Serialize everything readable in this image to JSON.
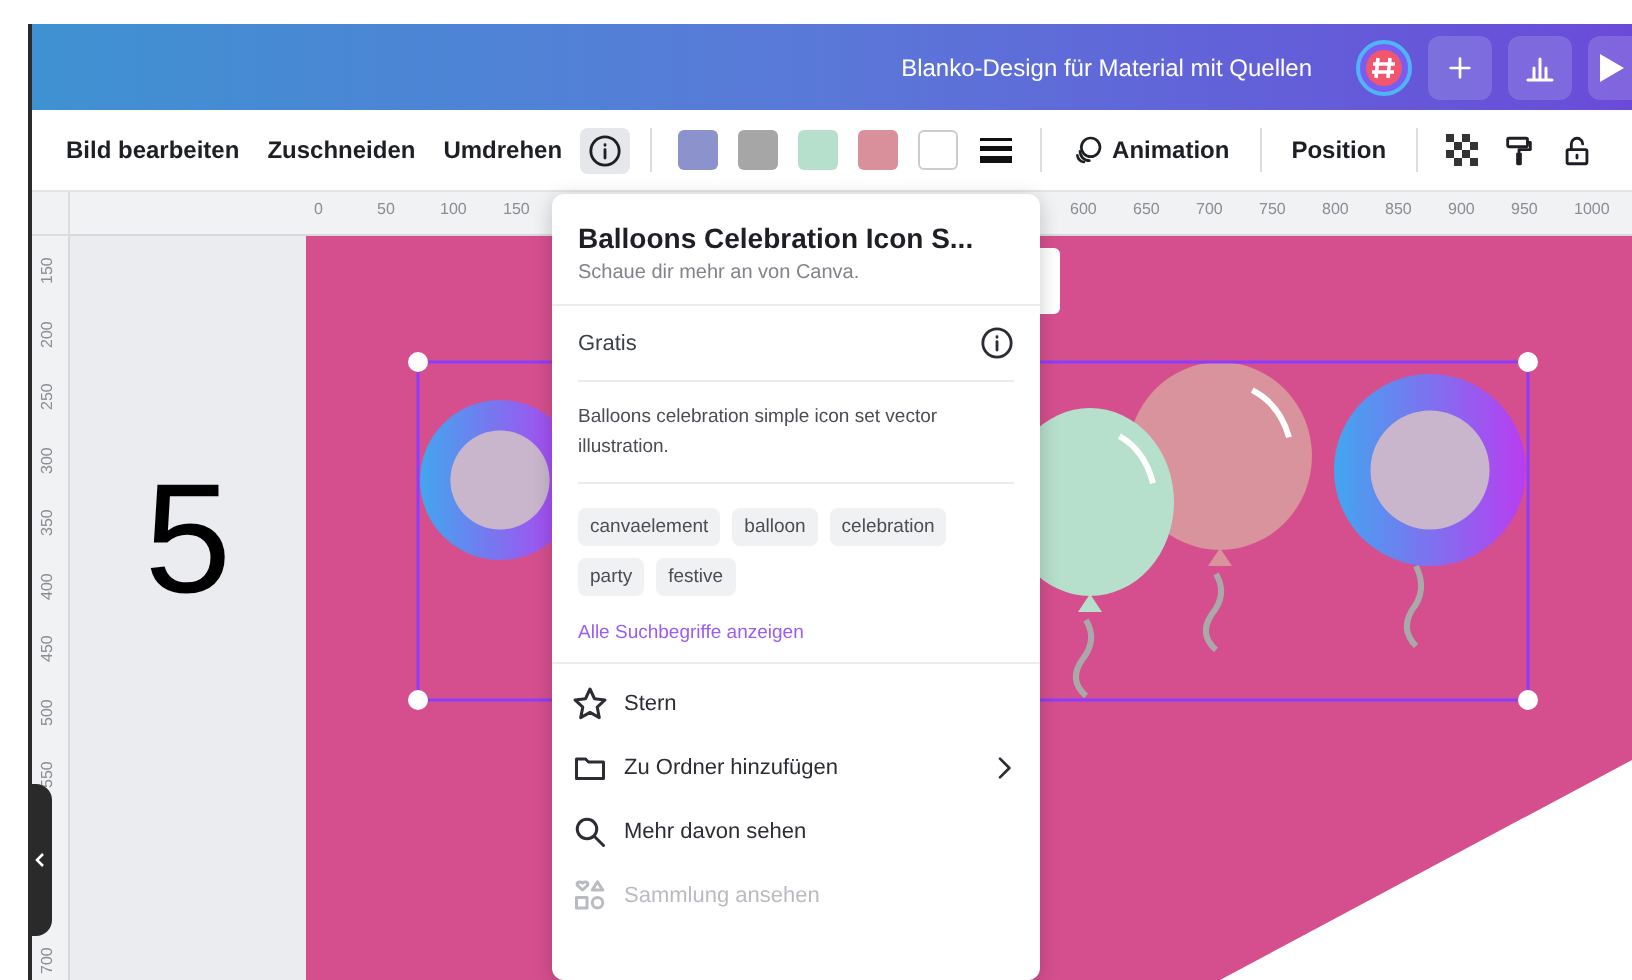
{
  "header": {
    "title": "Blanko-Design für Material mit Quellen"
  },
  "toolbar": {
    "actions": [
      {
        "label": "Bild bearbeiten"
      },
      {
        "label": "Zuschneiden"
      },
      {
        "label": "Umdrehen"
      }
    ],
    "info_button": {
      "selected": true
    },
    "swatches": [
      {
        "color": "#8c93cc"
      },
      {
        "color": "#a6a6a6"
      },
      {
        "color": "#b6dfcc"
      },
      {
        "color": "#d9909a"
      },
      {
        "color": "#ffffff"
      }
    ],
    "animation": {
      "label": "Animation"
    },
    "position": {
      "label": "Position"
    }
  },
  "rulers": {
    "top": {
      "before_popup": [
        "0",
        "50",
        "100",
        "150"
      ],
      "after_popup": [
        "600",
        "650",
        "700",
        "750",
        "800",
        "850",
        "900",
        "950",
        "1000"
      ]
    },
    "left": {
      "upper": [
        "150",
        "200",
        "250",
        "300",
        "350",
        "400",
        "450",
        "500",
        "550"
      ],
      "lower": [
        "700"
      ]
    }
  },
  "canvas": {
    "page_number": "5"
  },
  "popup": {
    "title": "Balloons Celebration Icon S...",
    "subtitle": "Schaue dir mehr an von Canva.",
    "license": "Gratis",
    "description": "Balloons celebration simple icon set vector illustration.",
    "tags": [
      "canvaelement",
      "balloon",
      "celebration",
      "party",
      "festive"
    ],
    "link": "Alle Suchbegriffe anzeigen",
    "menu": [
      {
        "kind": "star",
        "label": "Stern",
        "disabled": false,
        "submenu": false
      },
      {
        "kind": "folder",
        "label": "Zu Ordner hinzufügen",
        "disabled": false,
        "submenu": true
      },
      {
        "kind": "search",
        "label": "Mehr davon sehen",
        "disabled": false,
        "submenu": false
      },
      {
        "kind": "collection",
        "label": "Sammlung ansehen",
        "disabled": true,
        "submenu": false
      }
    ]
  }
}
